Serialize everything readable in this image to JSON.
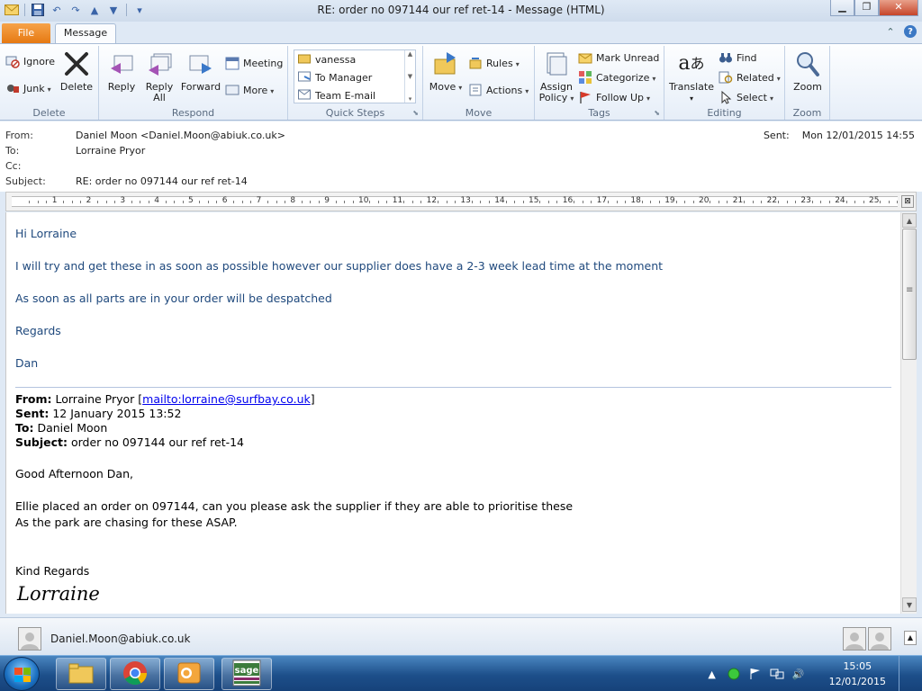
{
  "window": {
    "title": "RE: order no 097144   our ref ret-14  -  Message (HTML)",
    "controls": {
      "minimize": "▁",
      "maximize": "❐",
      "close": "✕"
    }
  },
  "tabs": {
    "file": "File",
    "message": "Message"
  },
  "ribbon": {
    "delete_group": {
      "label": "Delete",
      "ignore": "Ignore",
      "junk": "Junk",
      "delete": "Delete"
    },
    "respond_group": {
      "label": "Respond",
      "reply": "Reply",
      "reply_all_line1": "Reply",
      "reply_all_line2": "All",
      "forward": "Forward",
      "meeting": "Meeting",
      "more": "More"
    },
    "quick_steps_group": {
      "label": "Quick Steps",
      "items": [
        "vanessa",
        "To Manager",
        "Team E-mail"
      ]
    },
    "move_group": {
      "label": "Move",
      "move": "Move",
      "rules": "Rules",
      "actions": "Actions"
    },
    "tags_group": {
      "label": "Tags",
      "assign_policy_line1": "Assign",
      "assign_policy_line2": "Policy",
      "mark_unread": "Mark Unread",
      "categorize": "Categorize",
      "follow_up": "Follow Up"
    },
    "editing_group": {
      "label": "Editing",
      "translate": "Translate",
      "find": "Find",
      "related": "Related",
      "select": "Select"
    },
    "zoom_group": {
      "label": "Zoom",
      "zoom": "Zoom"
    }
  },
  "header": {
    "from_label": "From:",
    "from_value": "Daniel Moon <Daniel.Moon@abiuk.co.uk>",
    "to_label": "To:",
    "to_value": "Lorraine Pryor",
    "cc_label": "Cc:",
    "cc_value": "",
    "subject_label": "Subject:",
    "subject_value": "RE: order no 097144   our ref ret-14",
    "sent_label": "Sent:",
    "sent_value": "Mon 12/01/2015 14:55"
  },
  "ruler": {
    "numbers": [
      "1",
      "2",
      "3",
      "4",
      "5",
      "6",
      "7",
      "8",
      "9",
      "10",
      "11",
      "12",
      "13",
      "14",
      "15",
      "16",
      "17",
      "18",
      "19",
      "20",
      "21",
      "22",
      "23",
      "24",
      "25"
    ]
  },
  "body": {
    "reply": {
      "greeting": "Hi Lorraine",
      "line1": "I will try and get these in as soon as possible however our supplier does have a 2-3 week lead time at the moment",
      "line2": "As soon as all parts are in your order will be despatched",
      "closing": "Regards",
      "name": "Dan"
    },
    "original": {
      "from_label": "From:",
      "from_value": "Lorraine Pryor [",
      "from_link": "mailto:lorraine@surfbay.co.uk",
      "from_end": "]",
      "sent_label": "Sent:",
      "sent_value": "12 January 2015 13:52",
      "to_label": "To:",
      "to_value": "Daniel Moon",
      "subject_label": "Subject:",
      "subject_value": "order no 097144 our ref ret-14",
      "greeting": "Good Afternoon Dan,",
      "line1": "Ellie placed an order on 097144, can you please ask the supplier if they are able to prioritise these",
      "line2": "As the park are chasing for these ASAP.",
      "closing": "Kind Regards",
      "signature": "Lorraine"
    }
  },
  "people_pane": {
    "contact": "Daniel.Moon@abiuk.co.uk"
  },
  "taskbar": {
    "time": "15:05",
    "date": "12/01/2015"
  },
  "colors": {
    "file_tab": "#e67912",
    "reply_text": "#1f497d",
    "link": "#0000ee",
    "taskbar": "#1d4f8a"
  }
}
